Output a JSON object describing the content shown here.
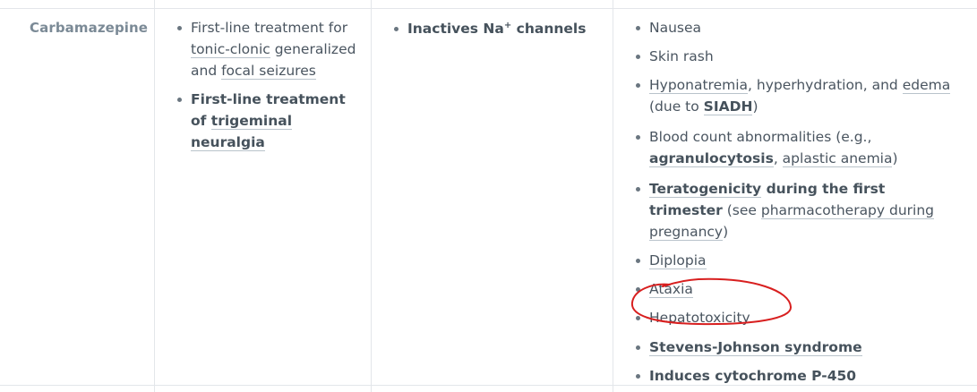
{
  "row": {
    "drug": "Carbamazepine",
    "indications": [
      {
        "parts": [
          {
            "text": "First-line treatment for ",
            "style": "plain"
          },
          {
            "text": "tonic-clonic",
            "style": "link"
          },
          {
            "text": " generalized and ",
            "style": "plain"
          },
          {
            "text": "focal seizures",
            "style": "link"
          }
        ]
      },
      {
        "parts": [
          {
            "text": "First-line treatment of ",
            "style": "bold"
          },
          {
            "text": "trigeminal neuralgia",
            "style": "bold-link"
          }
        ]
      }
    ],
    "mechanism": {
      "before": "Inactives Na",
      "sup": "+",
      "after": " channels"
    },
    "adverse_effects": [
      {
        "parts": [
          {
            "text": "Nausea",
            "style": "plain"
          }
        ]
      },
      {
        "parts": [
          {
            "text": "Skin rash",
            "style": "plain"
          }
        ]
      },
      {
        "parts": [
          {
            "text": "Hyponatremia",
            "style": "link"
          },
          {
            "text": ", hyperhydration, and ",
            "style": "plain"
          },
          {
            "text": "edema",
            "style": "link"
          },
          {
            "text": " (due to ",
            "style": "plain"
          },
          {
            "text": "SIADH",
            "style": "bold-link"
          },
          {
            "text": ")",
            "style": "plain"
          }
        ]
      },
      {
        "parts": [
          {
            "text": "Blood count abnormalities (e.g., ",
            "style": "plain"
          },
          {
            "text": "agranulocytosis",
            "style": "bold-link"
          },
          {
            "text": ", ",
            "style": "plain"
          },
          {
            "text": "aplastic anemia",
            "style": "link"
          },
          {
            "text": ")",
            "style": "plain"
          }
        ]
      },
      {
        "parts": [
          {
            "text": "Teratogenicity",
            "style": "bold-link"
          },
          {
            "text": " during the first trimester",
            "style": "bold"
          },
          {
            "text": " (see ",
            "style": "plain"
          },
          {
            "text": "pharmacotherapy during pregnancy",
            "style": "link"
          },
          {
            "text": ")",
            "style": "plain"
          }
        ]
      },
      {
        "parts": [
          {
            "text": "Diplopia",
            "style": "link"
          }
        ]
      },
      {
        "parts": [
          {
            "text": "Ataxia",
            "style": "link"
          }
        ]
      },
      {
        "parts": [
          {
            "text": "Hepatotoxicity",
            "style": "plain"
          }
        ]
      },
      {
        "parts": [
          {
            "text": "Stevens-Johnson syndrome",
            "style": "bold-link"
          }
        ]
      },
      {
        "parts": [
          {
            "text": "Induces cytochrome P-450",
            "style": "bold"
          }
        ]
      }
    ]
  },
  "annotation": {
    "color": "#d81f1f",
    "target": "Hepatotoxicity"
  }
}
